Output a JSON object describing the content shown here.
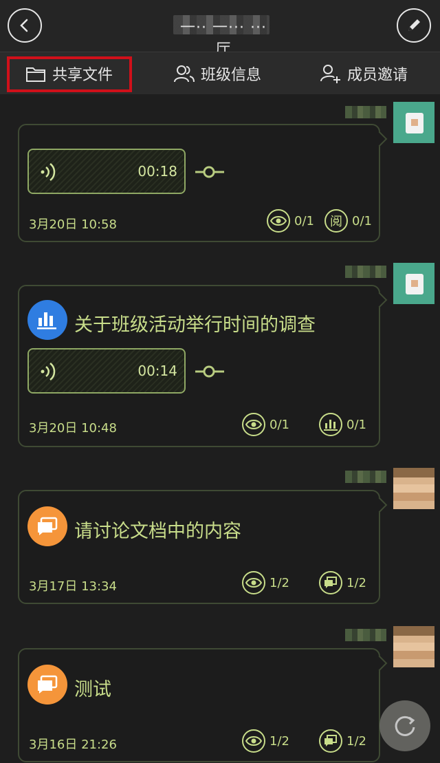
{
  "header": {
    "title": "一·· 一··· ··· 厅"
  },
  "tabs": [
    {
      "label": "共享文件",
      "icon": "folder-icon"
    },
    {
      "label": "班级信息",
      "icon": "people-icon"
    },
    {
      "label": "成员邀请",
      "icon": "add-user-icon"
    }
  ],
  "messages": [
    {
      "type": "audio",
      "audio_duration": "00:18",
      "date": "3月20日 10:58",
      "views": "0/1",
      "reads": "0/1",
      "read_icon_glyph": "阅"
    },
    {
      "type": "survey",
      "title": "关于班级活动举行时间的调查",
      "audio_duration": "00:14",
      "date": "3月20日 10:48",
      "views": "0/1",
      "votes": "0/1"
    },
    {
      "type": "discussion",
      "title": "请讨论文档中的内容",
      "date": "3月17日 13:34",
      "views": "1/2",
      "comments": "1/2"
    },
    {
      "type": "discussion",
      "title": "测试",
      "date": "3月16日 21:26",
      "views": "1/2",
      "comments": "1/2"
    }
  ],
  "colors": {
    "accent": "#c8dd8a",
    "highlight_box": "#d0101a",
    "survey_icon": "#2f7de1",
    "discussion_icon": "#f5953a"
  }
}
